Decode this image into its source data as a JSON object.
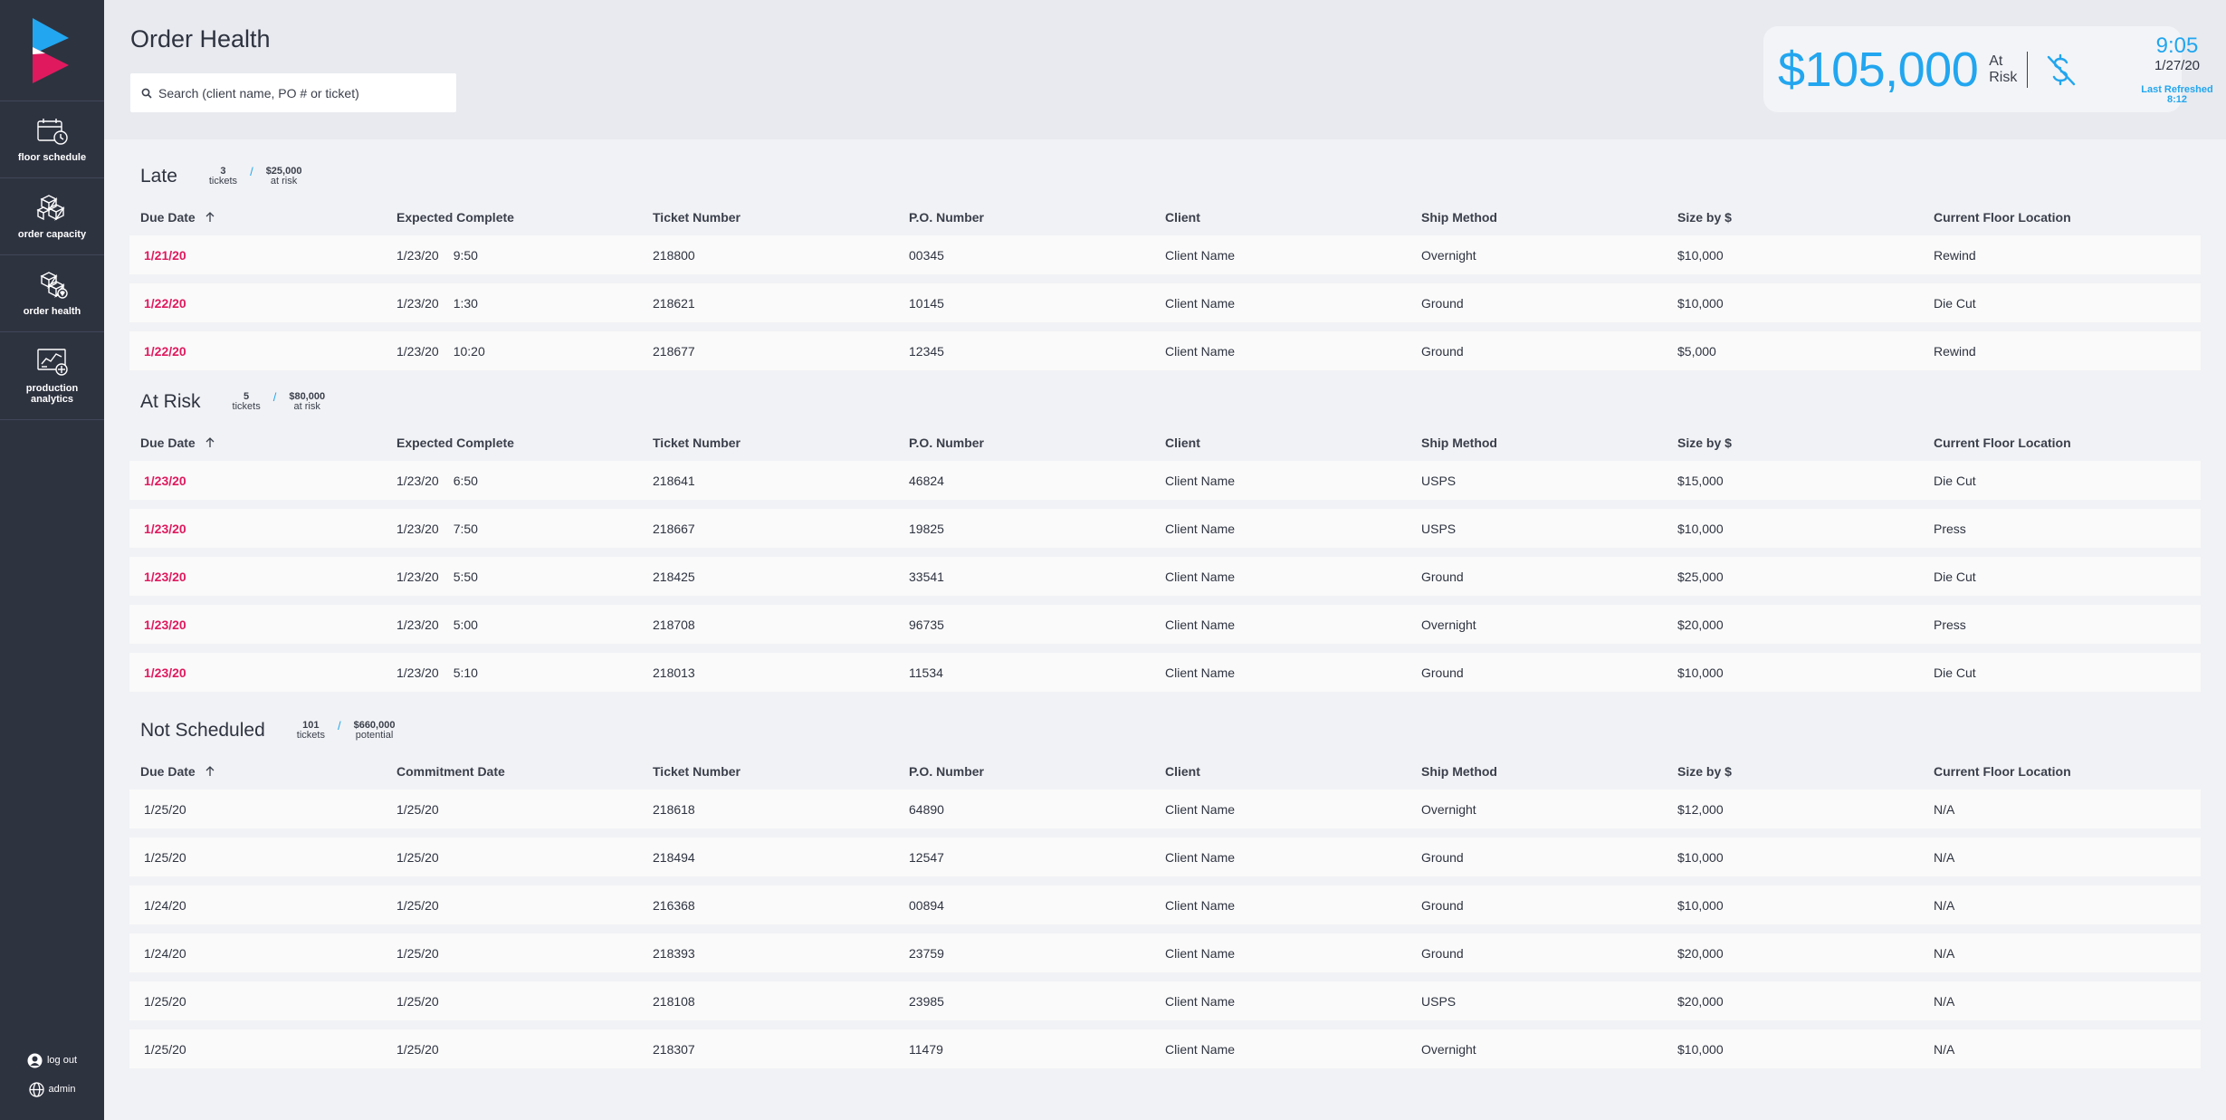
{
  "app": {
    "page_title": "Order Health",
    "search_placeholder": "Search (client name, PO # or ticket)"
  },
  "sidebar": {
    "items": [
      {
        "label": "floor schedule",
        "icon": "calendar-clock-icon"
      },
      {
        "label": "order capacity",
        "icon": "boxes-icon"
      },
      {
        "label": "order health",
        "icon": "boxes-heart-icon"
      },
      {
        "label": "production analytics",
        "icon": "analytics-chart-icon"
      }
    ],
    "logout_label": "log out",
    "admin_label": "admin"
  },
  "risk": {
    "amount": "$105,000",
    "label_line1": "At",
    "label_line2": "Risk"
  },
  "clock": {
    "time": "9:05",
    "date": "1/27/20",
    "refresh_label": "Last Refreshed",
    "refresh_time": "8:12"
  },
  "sections": {
    "late": {
      "title": "Late",
      "count": "3",
      "count_label": "tickets",
      "amount": "$25,000",
      "amount_label": "at risk",
      "headers": [
        "Due Date",
        "Expected Complete",
        "Ticket Number",
        "P.O. Number",
        "Client",
        "Ship Method",
        "Size by $",
        "Current Floor Location"
      ],
      "rows": [
        {
          "due": "1/21/20",
          "date": "1/23/20",
          "time": "9:50",
          "ticket": "218800",
          "po": "00345",
          "client": "Client Name",
          "ship": "Overnight",
          "size": "$10,000",
          "location": "Rewind"
        },
        {
          "due": "1/22/20",
          "date": "1/23/20",
          "time": "1:30",
          "ticket": "218621",
          "po": "10145",
          "client": "Client Name",
          "ship": "Ground",
          "size": "$10,000",
          "location": "Die Cut"
        },
        {
          "due": "1/22/20",
          "date": "1/23/20",
          "time": "10:20",
          "ticket": "218677",
          "po": "12345",
          "client": "Client Name",
          "ship": "Ground",
          "size": "$5,000",
          "location": "Rewind"
        }
      ]
    },
    "at_risk": {
      "title": "At Risk",
      "count": "5",
      "count_label": "tickets",
      "amount": "$80,000",
      "amount_label": "at risk",
      "headers": [
        "Due Date",
        "Expected Complete",
        "Ticket Number",
        "P.O. Number",
        "Client",
        "Ship Method",
        "Size by $",
        "Current Floor Location"
      ],
      "rows": [
        {
          "due": "1/23/20",
          "date": "1/23/20",
          "time": "6:50",
          "ticket": "218641",
          "po": "46824",
          "client": "Client Name",
          "ship": "USPS",
          "size": "$15,000",
          "location": "Die Cut"
        },
        {
          "due": "1/23/20",
          "date": "1/23/20",
          "time": "7:50",
          "ticket": "218667",
          "po": "19825",
          "client": "Client Name",
          "ship": "USPS",
          "size": "$10,000",
          "location": "Press"
        },
        {
          "due": "1/23/20",
          "date": "1/23/20",
          "time": "5:50",
          "ticket": "218425",
          "po": "33541",
          "client": "Client Name",
          "ship": "Ground",
          "size": "$25,000",
          "location": "Die Cut"
        },
        {
          "due": "1/23/20",
          "date": "1/23/20",
          "time": "5:00",
          "ticket": "218708",
          "po": "96735",
          "client": "Client Name",
          "ship": "Overnight",
          "size": "$20,000",
          "location": "Press"
        },
        {
          "due": "1/23/20",
          "date": "1/23/20",
          "time": "5:10",
          "ticket": "218013",
          "po": "11534",
          "client": "Client Name",
          "ship": "Ground",
          "size": "$10,000",
          "location": "Die Cut"
        }
      ]
    },
    "not_scheduled": {
      "title": "Not Scheduled",
      "count": "101",
      "count_label": "tickets",
      "amount": "$660,000",
      "amount_label": "potential",
      "headers": [
        "Due Date",
        "Commitment Date",
        "Ticket Number",
        "P.O. Number",
        "Client",
        "Ship Method",
        "Size by $",
        "Current Floor Location"
      ],
      "rows": [
        {
          "due": "1/25/20",
          "date": "1/25/20",
          "ticket": "218618",
          "po": "64890",
          "client": "Client Name",
          "ship": "Overnight",
          "size": "$12,000",
          "location": "N/A"
        },
        {
          "due": "1/25/20",
          "date": "1/25/20",
          "ticket": "218494",
          "po": "12547",
          "client": "Client Name",
          "ship": "Ground",
          "size": "$10,000",
          "location": "N/A"
        },
        {
          "due": "1/24/20",
          "date": "1/25/20",
          "ticket": "216368",
          "po": "00894",
          "client": "Client Name",
          "ship": "Ground",
          "size": "$10,000",
          "location": "N/A"
        },
        {
          "due": "1/24/20",
          "date": "1/25/20",
          "ticket": "218393",
          "po": "23759",
          "client": "Client Name",
          "ship": "Ground",
          "size": "$20,000",
          "location": "N/A"
        },
        {
          "due": "1/25/20",
          "date": "1/25/20",
          "ticket": "218108",
          "po": "23985",
          "client": "Client Name",
          "ship": "USPS",
          "size": "$20,000",
          "location": "N/A"
        },
        {
          "due": "1/25/20",
          "date": "1/25/20",
          "ticket": "218307",
          "po": "11479",
          "client": "Client Name",
          "ship": "Overnight",
          "size": "$10,000",
          "location": "N/A"
        }
      ]
    }
  },
  "colors": {
    "accent": "#22a6ef",
    "late_red": "#e0195e",
    "sidebar": "#2e3340"
  }
}
